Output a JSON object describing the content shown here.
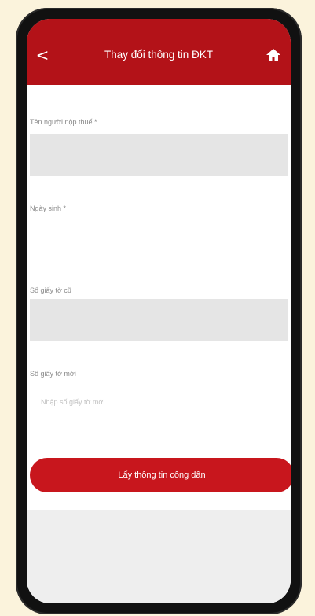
{
  "header": {
    "title": "Thay đổi thông tin ĐKT",
    "back_glyph": "<",
    "home_icon": "home-icon",
    "color": "#b31218"
  },
  "form": {
    "taxpayer_name_label": "Tên người nộp thuế *",
    "birth_date_label": "Ngày sinh *",
    "old_id_label": "Số giấy tờ cũ",
    "new_id_label": "Số giấy tờ mới",
    "new_id_placeholder": "Nhập số giấy tờ mới"
  },
  "actions": {
    "get_info_label": "Lấy thông tin công dân"
  }
}
